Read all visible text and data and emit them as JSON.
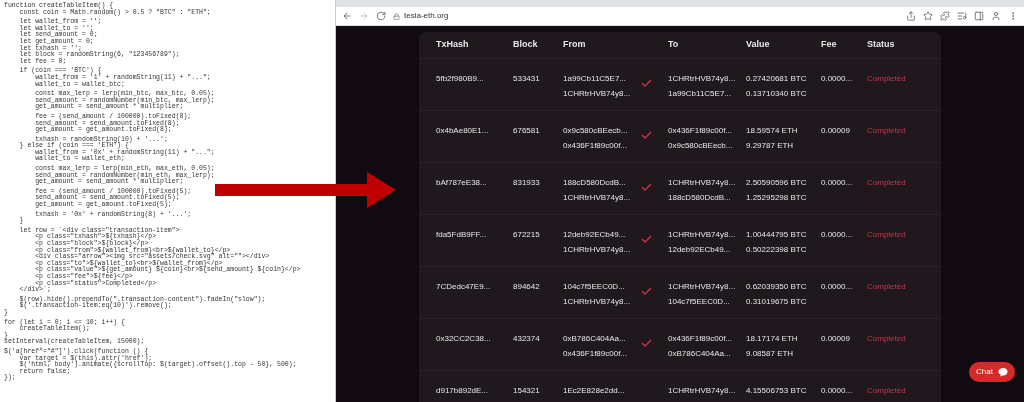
{
  "code_blocks": [
    [
      "function createTableItem() {",
      "    const coin = Math.random() > 0.5 ? \"BTC\" : \"ETH\";"
    ],
    [
      "    let wallet_from = '';",
      "    let wallet_to = '';",
      "    let send_amount = 0;",
      "    let get_amount = 0;",
      "    let txhash = '';",
      "    let block = randomString(6, \"123456789\");",
      "    let fee = 0;"
    ],
    [
      "    if (coin === 'BTC') {",
      "        wallet_from = '1' + randomString(11) + \"...\";",
      "        wallet_to = wallet_btc;"
    ],
    [
      "        const max_lerp = lerp(min_btc, max_btc, 0.05);",
      "        send_amount = randomNumber(min_btc, max_lerp);",
      "        get_amount = send_amount * multiplier;"
    ],
    [
      "        fee = (send_amount / 100000).toFixed(8);",
      "        send_amount = send_amount.toFixed(8);",
      "        get_amount = get_amount.toFixed(8);"
    ],
    [
      "        txhash = randomString(10) + '...';",
      "    } else if (coin === 'ETH') {",
      "        wallet_from = '0x' + randomString(11) + \"...\";",
      "        wallet_to = wallet_eth;"
    ],
    [
      "        const max_lerp = lerp(min_eth, max_eth, 0.05);",
      "        send_amount = randomNumber(min_eth, max_lerp);",
      "        get_amount = send_amount * multiplier;"
    ],
    [
      "        fee = (send_amount / 100000).toFixed(5);",
      "        send_amount = send_amount.toFixed(5);",
      "        get_amount = get_amount.toFixed(5);"
    ],
    [
      "        txhash = '0x' + randomString(8) + '...';",
      "    }"
    ],
    [
      "    let row = `<div class=\"transaction-item\">",
      "        <p class=\"txhash\">${txhash}</p>",
      "        <p class=\"block\">${block}</p>",
      "        <p class=\"from\">${wallet_from}<br>${wallet_to}</p>",
      "        <div class=\"arrow\"><img src=\"assets/check.svg\" alt=\"\"></div>",
      "        <p class=\"to\">${wallet_to}<br>${wallet_from}</p>",
      "        <p class=\"value\">${get_amount} ${coin}<br>${send_amount} ${coin}</p>",
      "        <p class=\"fee\">${fee}</p>",
      "        <p class=\"status\">Completed</p>",
      "    </div>`;"
    ],
    [
      "    $(row).hide().prependTo(\".transaction-content\").fadeIn(\"slow\");",
      "    $('.transaction-item:eq(10)').remove();",
      "}"
    ],
    [
      "for (let i = 0; i <= 10; i++) {",
      "    createTableItem();",
      "}",
      "setInterval(createTableItem, 15000);"
    ],
    [
      "$('a[href^=\"#\"]').click(function () {",
      "    var target = $(this).attr('href');",
      "    $('html, body').animate({scrollTop: $(target).offset().top - 50}, 500);",
      "    return false;",
      "});"
    ]
  ],
  "browser": {
    "url": "tesla-eth.org"
  },
  "table": {
    "columns": [
      "TxHash",
      "Block",
      "From",
      "To",
      "Value",
      "Fee",
      "Status"
    ],
    "rows": [
      {
        "txhash": "5fb2f980B9...",
        "block": "533431",
        "from": [
          "1a99Cb11C5E7...",
          "1CHRtrHVB74y8..."
        ],
        "confirmed": true,
        "to": [
          "1CHRtrHVB74y8...",
          "1a99Cb11C5E7..."
        ],
        "value": [
          "0.27420681 BTC",
          "0.13710340 BTC"
        ],
        "fee": "0.0000...",
        "status": "Completed"
      },
      {
        "txhash": "0x4bAe80E1...",
        "block": "676581",
        "from": [
          "0x9c580cBEecb...",
          "0x436F1f89c00f..."
        ],
        "confirmed": true,
        "to": [
          "0x436F1f89c00f...",
          "0x9c580cBEecb..."
        ],
        "value": [
          "18.59574 ETH",
          "9.29787 ETH"
        ],
        "fee": "0.00009",
        "status": "Completed"
      },
      {
        "txhash": "bAf787eE38...",
        "block": "831933",
        "from": [
          "188cD580DcdB...",
          "1CHRtrHVB74y8..."
        ],
        "confirmed": true,
        "to": [
          "1CHRtrHVB74y8...",
          "188cD580DcdB..."
        ],
        "value": [
          "2.50590596 BTC",
          "1.25295298 BTC"
        ],
        "fee": "0.0000...",
        "status": "Completed"
      },
      {
        "txhash": "fda5FdB9FF...",
        "block": "672215",
        "from": [
          "12deb92ECb49...",
          "1CHRtrHVB74y8..."
        ],
        "confirmed": true,
        "to": [
          "1CHRtrHVB74y8...",
          "12deb92ECb49..."
        ],
        "value": [
          "1.00444795 BTC",
          "0.50222398 BTC"
        ],
        "fee": "0.0000...",
        "status": "Completed"
      },
      {
        "txhash": "7CDedc47E9...",
        "block": "894642",
        "from": [
          "104c7f5EEC0D...",
          "1CHRtrHVB74y8..."
        ],
        "confirmed": true,
        "to": [
          "1CHRtrHVB74y8...",
          "104c7f5EEC0D..."
        ],
        "value": [
          "0.62039350 BTC",
          "0.31019675 BTC"
        ],
        "fee": "0.0000...",
        "status": "Completed"
      },
      {
        "txhash": "0x32CC2C38...",
        "block": "432374",
        "from": [
          "0xB786C404Aa...",
          "0x436F1f89c00f..."
        ],
        "confirmed": true,
        "to": [
          "0x436F1f89c00f...",
          "0xB786C404Aa..."
        ],
        "value": [
          "18.17174 ETH",
          "9.08587 ETH"
        ],
        "fee": "0.00009",
        "status": "Completed"
      },
      {
        "txhash": "d917b892dE...",
        "block": "154321",
        "from": [
          "1Ec2E828e2dd..."
        ],
        "confirmed": false,
        "to": [
          "1CHRtrHVB74y8..."
        ],
        "value": [
          "4.15506753 BTC"
        ],
        "fee": "0.0000...",
        "status": "Completed"
      }
    ]
  },
  "chat_button": {
    "label": "Chat"
  }
}
